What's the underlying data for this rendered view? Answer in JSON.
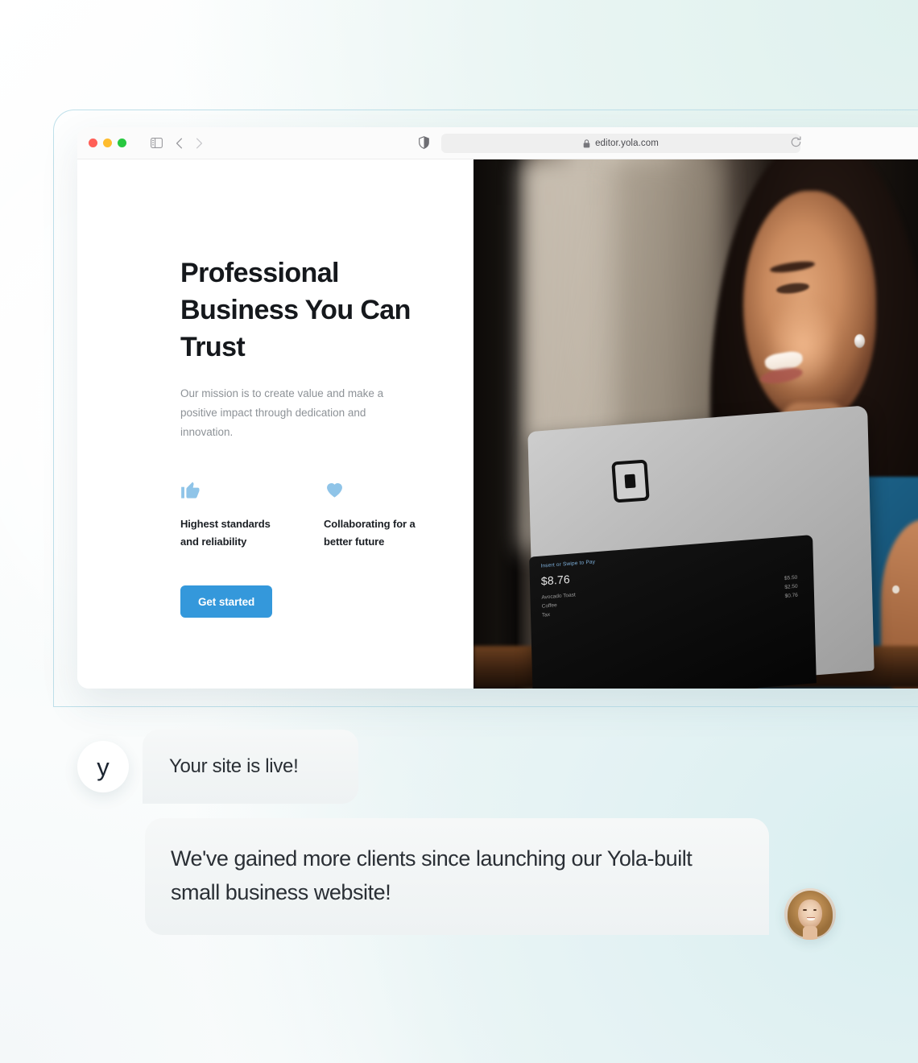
{
  "browser": {
    "traffic_lights": [
      "close",
      "minimize",
      "maximize"
    ],
    "sidebar_toggle_icon": "sidebar-icon",
    "back_icon": "chevron-left-icon",
    "forward_icon": "chevron-right-icon",
    "shield_icon": "shield-icon",
    "lock_icon": "lock-icon",
    "url": "editor.yola.com",
    "reload_icon": "reload-icon"
  },
  "site": {
    "hero": {
      "title": "Professional Business You Can Trust",
      "subtitle": "Our mission is to create value and make a positive impact through dedication and innovation.",
      "cta_label": "Get started",
      "features": [
        {
          "icon": "thumbs-up-icon",
          "label": "Highest standards and reliability"
        },
        {
          "icon": "heart-icon",
          "label": "Collaborating for a better future"
        }
      ]
    },
    "photo": {
      "alt": "Smiling woman in blue top holding a tablet point-of-sale terminal",
      "pos": {
        "header": "Insert or Swipe to Pay",
        "total": "$8.76",
        "line_items": [
          {
            "name": "Avocado Toast",
            "price": "$5.50"
          },
          {
            "name": "Coffee",
            "price": "$2.50"
          },
          {
            "name": "Tax",
            "price": "$0.76"
          }
        ]
      },
      "brand_mark": "square-logo-icon"
    }
  },
  "chat": {
    "messages": [
      {
        "avatar_type": "yola-logo",
        "avatar_letter": "y",
        "text": "Your site is live!"
      },
      {
        "avatar_type": "client-photo",
        "text": "We've gained more clients since launching our Yola-built small business website!"
      }
    ]
  },
  "colors": {
    "accent_blue": "#3498db",
    "icon_blue": "#8fc4e8",
    "bubble_bg": "#f1f4f5",
    "heading_dark": "#15181c",
    "body_grey": "#8d9297",
    "window_border": "#bfe0ea",
    "page_bg_mint": "#e7f3f3"
  }
}
